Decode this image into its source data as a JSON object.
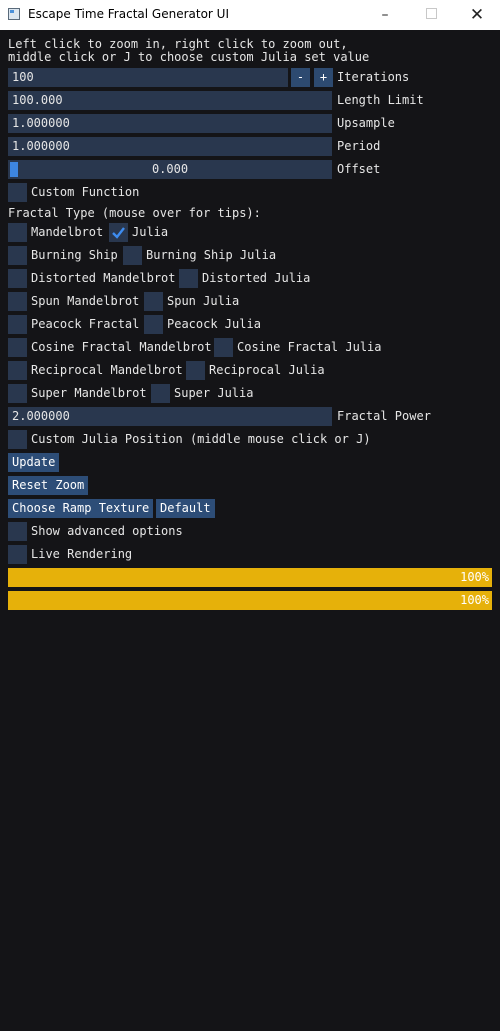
{
  "window": {
    "title": "Escape Time Fractal Generator UI",
    "minimize": "–",
    "close": "✕"
  },
  "intro": "Left click to zoom in, right click to zoom out,\nmiddle click or J to choose custom Julia set value",
  "iterations": {
    "value": "100",
    "minus": "-",
    "plus": "+",
    "label": "Iterations"
  },
  "length_limit": {
    "value": "100.000",
    "label": "Length Limit"
  },
  "upsample": {
    "value": "1.000000",
    "label": "Upsample"
  },
  "period": {
    "value": "1.000000",
    "label": "Period"
  },
  "offset": {
    "value": "0.000",
    "label": "Offset",
    "slider_fraction": 0.0
  },
  "custom_function": {
    "label": "Custom Function",
    "checked": false
  },
  "fractal_type_heading": "Fractal Type (mouse over for tips):",
  "fractal_types": [
    {
      "left": "Mandelbrot",
      "right": "Julia",
      "right_checked": true
    },
    {
      "left": "Burning Ship",
      "right": "Burning Ship Julia"
    },
    {
      "left": "Distorted Mandelbrot",
      "right": "Distorted Julia"
    },
    {
      "left": "Spun Mandelbrot",
      "right": "Spun Julia"
    },
    {
      "left": "Peacock Fractal",
      "right": "Peacock Julia"
    },
    {
      "left": "Cosine Fractal Mandelbrot",
      "right": "Cosine Fractal Julia"
    },
    {
      "left": "Reciprocal Mandelbrot",
      "right": "Reciprocal Julia"
    },
    {
      "left": "Super Mandelbrot",
      "right": "Super Julia"
    }
  ],
  "fractal_power": {
    "value": "2.000000",
    "label": "Fractal Power"
  },
  "custom_julia": {
    "label": "Custom Julia Position (middle mouse click or J)"
  },
  "buttons": {
    "update": "Update",
    "reset_zoom": "Reset Zoom",
    "choose_ramp": "Choose Ramp Texture",
    "default": "Default"
  },
  "advanced": {
    "label": "Show advanced options"
  },
  "live": {
    "label": "Live Rendering"
  },
  "progress": [
    {
      "text": "100%",
      "value": 1.0
    },
    {
      "text": "100%",
      "value": 1.0
    }
  ],
  "colors": {
    "background": "#141417",
    "frame": "#29374e",
    "button": "#2d4d77",
    "accent": "#3d85e0",
    "progress": "#e6b10a"
  }
}
